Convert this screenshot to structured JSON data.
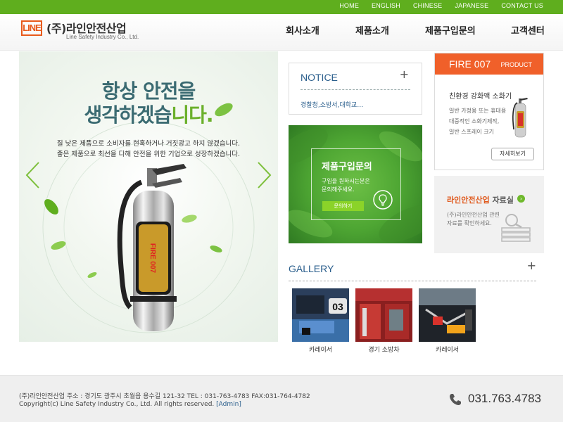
{
  "top_links": [
    "HOME",
    "ENGLISH",
    "CHINESE",
    "JAPANESE",
    "CONTACT US"
  ],
  "logo": {
    "mark": "LINE",
    "name_kr": "(주)라인안전산업",
    "name_en": "Line Safety Industry Co., Ltd."
  },
  "gnb": [
    "회사소개",
    "제품소개",
    "제품구입문의",
    "고객센터"
  ],
  "visual": {
    "headline_1": "항상 안전을",
    "headline_2a": "생각하겠습",
    "headline_2b": "니다.",
    "sub_1": "질 낮은 제품으로 소비자를 현혹하거나 거짓광고 하지 않겠습니다.",
    "sub_2": "좋은 제품으로 최선을 다해 안전을 위한 기업으로 성장하겠습니다.",
    "label_text": "FIRE 007"
  },
  "notice": {
    "title": "NOTICE",
    "plus": "+",
    "items": [
      "경찰청,소방서,대학교…"
    ]
  },
  "inquiry": {
    "title": "제품구입문의",
    "desc_1": "구입을 원하시는분은",
    "desc_2": "문의해주세요.",
    "button": "문의하기"
  },
  "product": {
    "code": "FIRE 007",
    "label": "PRODUCT",
    "name": "친환경 강화액 소화기",
    "desc": [
      "일반 가정용 또는 휴대용",
      "대중적인 소화기제작,",
      "일반 스프레이 크기"
    ],
    "more": "자세히보기"
  },
  "archive": {
    "title_orange": "라인안전산업",
    "title_dark": " 자료실",
    "desc": [
      "(주)라인안전산업 관련",
      "자료를 확인하세요."
    ]
  },
  "gallery": {
    "title": "GALLERY",
    "plus": "+",
    "items": [
      {
        "caption": "카레이서"
      },
      {
        "caption": "경기 소방차"
      },
      {
        "caption": "카레이서"
      }
    ]
  },
  "footer": {
    "address": "(주)라인안전산업     주소 : 경기도 광주시 초월읍 용수길 121-32     TEL : 031-763-4783     FAX:031-764-4782",
    "copyright": "Copyright(c) Line Safety Industry Co., Ltd. All rights reserved. ",
    "admin": "[Admin]",
    "phone": "031.763.4783"
  },
  "colors": {
    "brand_green": "#5fae1e",
    "accent_orange": "#f0602a",
    "link_blue": "#2a5e8c"
  }
}
